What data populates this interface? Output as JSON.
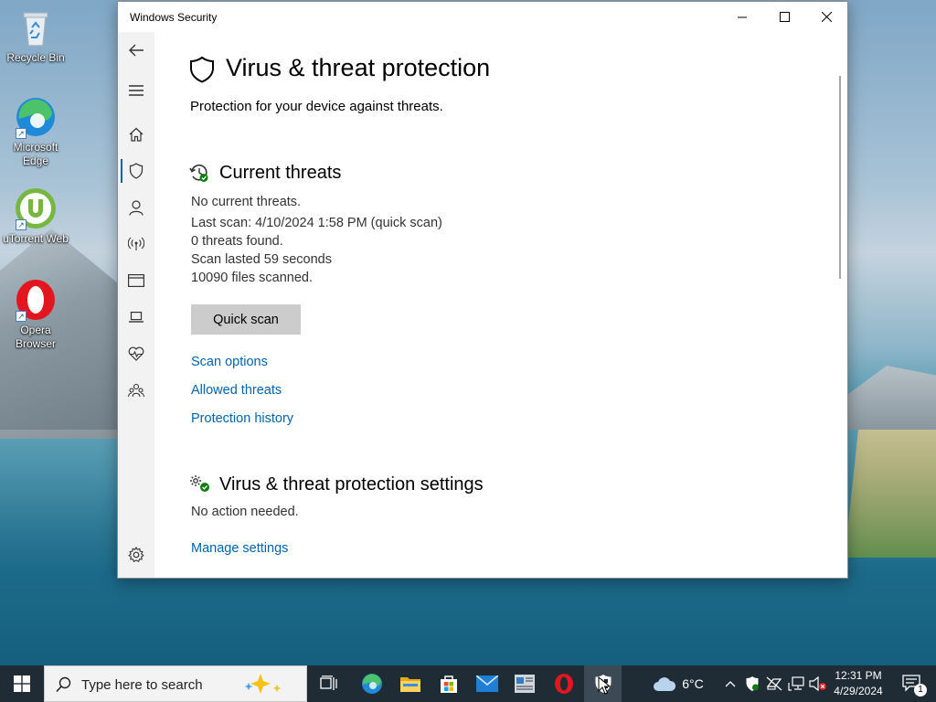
{
  "desktop": {
    "icons": [
      {
        "label": "Recycle Bin",
        "icon": "recycle-bin-icon"
      },
      {
        "label": "Microsoft Edge",
        "icon": "edge-icon"
      },
      {
        "label": "uTorrent Web",
        "icon": "utorrent-icon"
      },
      {
        "label": "Opera Browser",
        "icon": "opera-icon"
      }
    ]
  },
  "window": {
    "title": "Windows Security",
    "sidebar": {
      "items": [
        "back",
        "menu",
        "home",
        "virus-threat",
        "account",
        "firewall-network",
        "app-browser",
        "device-security",
        "device-health",
        "family",
        "settings"
      ],
      "active": "virus-threat"
    },
    "page": {
      "title": "Virus & threat protection",
      "subtitle": "Protection for your device against threats."
    },
    "current_threats": {
      "title": "Current threats",
      "status": "No current threats.",
      "last_scan": "Last scan: 4/10/2024 1:58 PM (quick scan)",
      "threats_found": "0 threats found.",
      "duration": "Scan lasted 59 seconds",
      "files": "10090 files scanned.",
      "quick_scan_label": "Quick scan",
      "links": [
        "Scan options",
        "Allowed threats",
        "Protection history"
      ]
    },
    "settings_section": {
      "title": "Virus & threat protection settings",
      "status": "No action needed.",
      "link": "Manage settings"
    }
  },
  "taskbar": {
    "search_placeholder": "Type here to search",
    "weather": "6°C",
    "time": "12:31 PM",
    "date": "4/29/2024",
    "notification_count": "1",
    "apps": [
      "task-view-icon",
      "edge-icon",
      "file-explorer-icon",
      "microsoft-store-icon",
      "mail-icon",
      "news-icon",
      "opera-icon",
      "windows-security-icon"
    ]
  },
  "colors": {
    "accent": "#0063b1",
    "button_bg": "#cccccc",
    "sidebar_bg": "#f2f2f2",
    "taskbar_bg": "#1f2b35",
    "status_green": "#107c10"
  }
}
